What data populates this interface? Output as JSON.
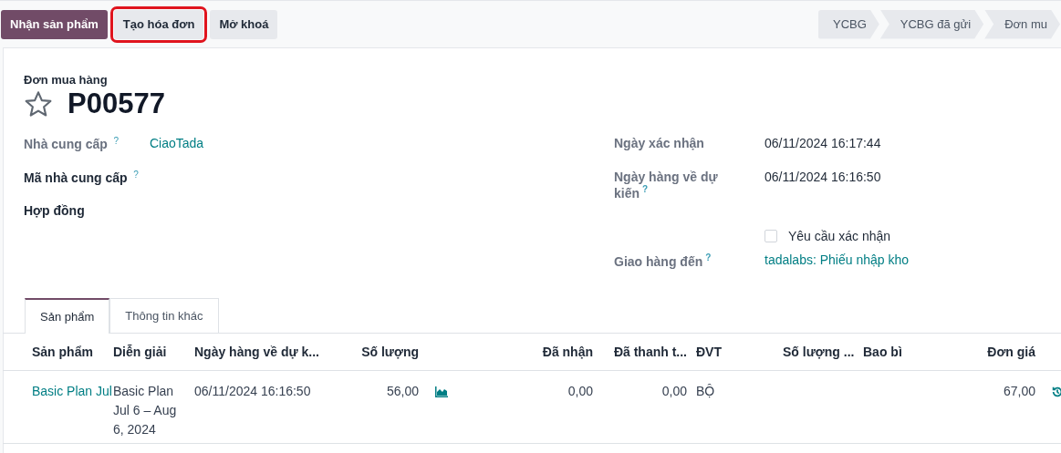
{
  "action_buttons": [
    {
      "label": "Nhận sản phẩm",
      "kind": "primary",
      "highlighted": false
    },
    {
      "label": "Tạo hóa đơn",
      "kind": "secondary",
      "highlighted": true
    },
    {
      "label": "Mở khoá",
      "kind": "secondary",
      "highlighted": false
    }
  ],
  "status_stages": [
    {
      "label": "YCBG",
      "selected": false
    },
    {
      "label": "YCBG đã gửi",
      "selected": false
    },
    {
      "label": "Đơn mu",
      "selected": false
    }
  ],
  "record": {
    "caption": "Đơn mua hàng",
    "name": "P00577",
    "starred": false
  },
  "left_fields": [
    {
      "label": "Nhà cung cấp",
      "help": "?",
      "value": "CiaoTada",
      "kind": "link",
      "bold": false
    },
    {
      "label": "Mã nhà cung cấp",
      "help": "?",
      "bold": true
    },
    {
      "label": "Hợp đồng",
      "bold": true
    }
  ],
  "right_fields": [
    {
      "label": "Ngày xác nhận",
      "value": "06/11/2024 16:17:44",
      "kind": "text"
    },
    {
      "label": "Ngày hàng về dự kiến",
      "help": "?",
      "value": "06/11/2024 16:16:50",
      "kind": "text"
    },
    {
      "kind": "checkbox",
      "value": "Yêu cầu xác nhận",
      "checked": false
    },
    {
      "label": "Giao hàng đến",
      "help": "?",
      "value": "tadalabs: Phiếu nhập kho",
      "kind": "link"
    }
  ],
  "tabs": [
    {
      "label": "Sản phẩm",
      "selected": true
    },
    {
      "label": "Thông tin khác",
      "selected": false
    }
  ],
  "table": {
    "columns": [
      {
        "label": "Sản phẩm"
      },
      {
        "label": "Diễn giải"
      },
      {
        "label": "Ngày hàng về dự k..."
      },
      {
        "label": "Số lượng"
      },
      {},
      {
        "label": "Đã nhận"
      },
      {
        "label": "Đã thanh t..."
      },
      {
        "label": "ĐVT"
      },
      {
        "label": "Số lượng ..."
      },
      {
        "label": "Bao bì"
      },
      {
        "label": "Đơn giá"
      },
      {}
    ],
    "rows": [
      {
        "cells": [
          {
            "kind": "link",
            "text": "Basic Plan Jul"
          },
          {
            "kind": "text",
            "text": "Basic Plan Jul 6 – Aug 6, 2024"
          },
          {
            "kind": "text",
            "text": "06/11/2024 16:16:50"
          },
          {
            "kind": "text",
            "text": "56,00"
          },
          {
            "kind": "chart-icon"
          },
          {
            "kind": "text",
            "text": "0,00"
          },
          {
            "kind": "text",
            "text": "0,00"
          },
          {
            "kind": "text",
            "text": "BỘ"
          },
          {
            "kind": "empty"
          },
          {
            "kind": "empty"
          },
          {
            "kind": "text",
            "text": "67,00"
          },
          {
            "kind": "history-icon"
          }
        ]
      }
    ]
  }
}
